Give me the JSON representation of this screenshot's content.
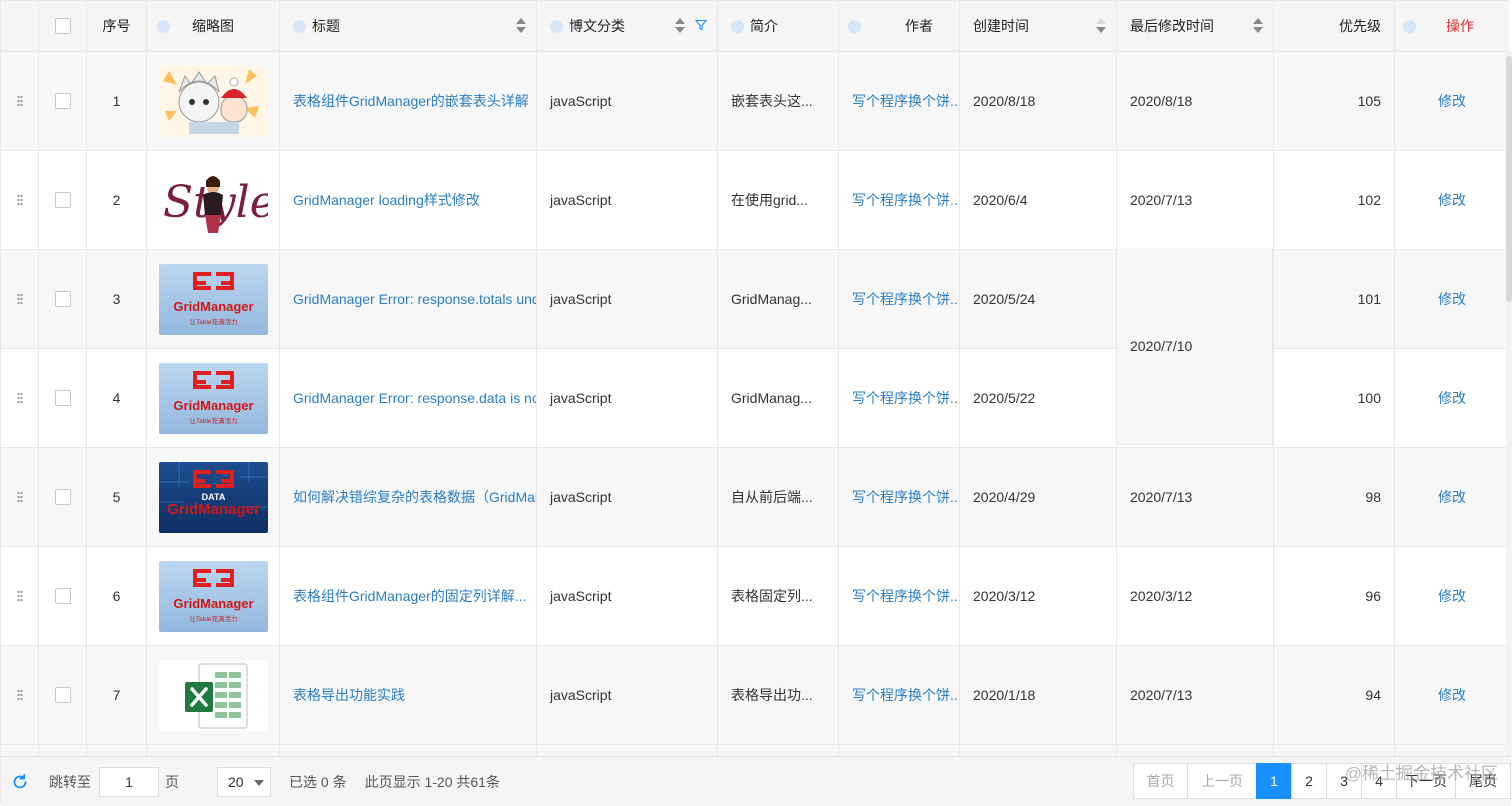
{
  "headers": {
    "index": "序号",
    "thumb": "缩略图",
    "title": "标题",
    "type": "博文分类",
    "desc": "简介",
    "author": "作者",
    "ctime": "创建时间",
    "mtime": "最后修改时间",
    "priority": "优先级",
    "op": "操作"
  },
  "rows": [
    {
      "index": "1",
      "title": "表格组件GridManager的嵌套表头详解",
      "type": "javaScript",
      "desc": "嵌套表头这...",
      "author": "写个程序换个饼...",
      "ctime": "2020/8/18",
      "mtime": "2020/8/18",
      "priority": "105",
      "op": "修改",
      "thumb": "cartoon-thumbnail"
    },
    {
      "index": "2",
      "title": "GridManager loading样式修改",
      "type": "javaScript",
      "desc": "在使用grid...",
      "author": "写个程序换个饼...",
      "ctime": "2020/6/4",
      "mtime": "2020/7/13",
      "priority": "102",
      "op": "修改",
      "thumb": "style-thumbnail"
    },
    {
      "index": "3",
      "title": "GridManager Error: response.totals undefined",
      "type": "javaScript",
      "desc": "GridManag...",
      "author": "写个程序换个饼...",
      "ctime": "2020/5/24",
      "mtime": "",
      "priority": "101",
      "op": "修改",
      "thumb": "gridmanager-logo"
    },
    {
      "index": "4",
      "title": "GridManager Error: response.data is not array",
      "type": "javaScript",
      "desc": "GridManag...",
      "author": "写个程序换个饼...",
      "ctime": "2020/5/22",
      "mtime": "",
      "priority": "100",
      "op": "修改",
      "thumb": "gridmanager-logo"
    },
    {
      "index": "5",
      "title": "如何解决错综复杂的表格数据（GridManager）",
      "type": "javaScript",
      "desc": "自从前后端...",
      "author": "写个程序换个饼...",
      "ctime": "2020/4/29",
      "mtime": "2020/7/13",
      "priority": "98",
      "op": "修改",
      "thumb": "data-gridmanager"
    },
    {
      "index": "6",
      "title": "表格组件GridManager的固定列详解...",
      "type": "javaScript",
      "desc": "表格固定列...",
      "author": "写个程序换个饼...",
      "ctime": "2020/3/12",
      "mtime": "2020/3/12",
      "priority": "96",
      "op": "修改",
      "thumb": "gridmanager-logo"
    },
    {
      "index": "7",
      "title": "表格导出功能实践",
      "type": "javaScript",
      "desc": "表格导出功...",
      "author": "写个程序换个饼...",
      "ctime": "2020/1/18",
      "mtime": "2020/7/13",
      "priority": "94",
      "op": "修改",
      "thumb": "excel-icon"
    }
  ],
  "merged_mtime": "2020/7/10",
  "logo": {
    "brand": "GridManager",
    "tagline": "让Table充满活力",
    "data": "DATA",
    "style": "Style"
  },
  "footer": {
    "jump_label": "跳转至",
    "page_value": "1",
    "page_unit": "页",
    "page_size": "20",
    "selected": "已选 0 条",
    "range": "此页显示 1-20 共61条"
  },
  "pager": {
    "first": "首页",
    "prev": "上一页",
    "pages": [
      "1",
      "2",
      "3",
      "4"
    ],
    "current": "1",
    "next": "下一页",
    "last": "尾页"
  },
  "watermark": "@稀土掘金技术社区",
  "colors": {
    "link": "#2b7ec1",
    "accent": "#1890ff",
    "danger": "#e02a2a"
  }
}
